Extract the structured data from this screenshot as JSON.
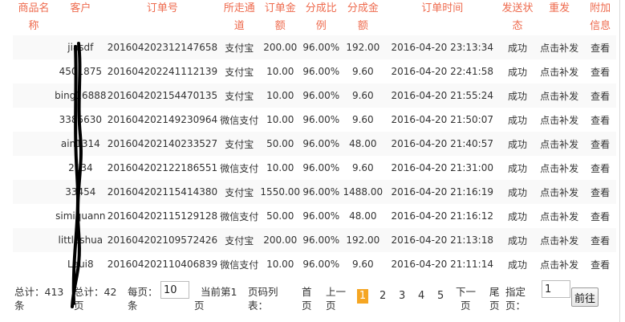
{
  "table": {
    "headers": [
      "商品名称",
      "客户",
      "订单号",
      "所走通道",
      "订单金额",
      "分成比例",
      "分成金额",
      "订单时间",
      "发送状态",
      "重发",
      "附加信息"
    ],
    "rows": [
      [
        "",
        "jiasdf",
        "201604202312147658",
        "支付宝",
        "200.00",
        "96.00%",
        "192.00",
        "2016-04-20 23:13:34",
        "成功",
        "点击补发",
        "查看"
      ],
      [
        "",
        "4501875",
        "201604202241112139",
        "支付宝",
        "10.00",
        "96.00%",
        "9.60",
        "2016-04-20 22:41:58",
        "成功",
        "点击补发",
        "查看"
      ],
      [
        "",
        "bing16888",
        "201604202154470135",
        "支付宝",
        "10.00",
        "96.00%",
        "9.60",
        "2016-04-20 21:55:24",
        "成功",
        "点击补发",
        "查看"
      ],
      [
        "",
        "3385630",
        "201604202149230964",
        "微信支付",
        "10.00",
        "96.00%",
        "9.60",
        "2016-04-20 21:50:07",
        "成功",
        "点击补发",
        "查看"
      ],
      [
        "",
        "ain1314",
        "201604202140233527",
        "支付宝",
        "50.00",
        "96.00%",
        "48.00",
        "2016-04-20 21:40:57",
        "成功",
        "点击补发",
        "查看"
      ],
      [
        "",
        "2134",
        "201604202122186551",
        "微信支付",
        "10.00",
        "96.00%",
        "9.60",
        "2016-04-20 21:31:00",
        "成功",
        "点击补发",
        "查看"
      ],
      [
        "",
        "33454",
        "201604202115414380",
        "支付宝",
        "1550.00",
        "96.00%",
        "1488.00",
        "2016-04-20 21:16:19",
        "成功",
        "点击补发",
        "查看"
      ],
      [
        "",
        "simiquann",
        "201604202115129128",
        "微信支付",
        "50.00",
        "96.00%",
        "48.00",
        "2016-04-20 21:16:12",
        "成功",
        "点击补发",
        "查看"
      ],
      [
        "",
        "littleshua",
        "201604202109572426",
        "支付宝",
        "200.00",
        "96.00%",
        "192.00",
        "2016-04-20 21:13:18",
        "成功",
        "点击补发",
        "查看"
      ],
      [
        "",
        "Laui8",
        "201604202110406839",
        "微信支付",
        "10.00",
        "96.00%",
        "9.60",
        "2016-04-20 21:11:14",
        "成功",
        "点击补发",
        "查看"
      ]
    ]
  },
  "pager": {
    "total_records": "总计：413",
    "total_records_unit": "条",
    "total_pages": "总计：42",
    "total_pages_unit": "页",
    "per_page_label": "每页：",
    "per_page_value": "10",
    "per_page_unit": "条",
    "current_page_label": "当前第1",
    "current_page_unit": "页",
    "page_list_label": "页码列",
    "page_list_label2": "表：",
    "first_label": "首",
    "first_label2": "页",
    "prev_label": "上一",
    "prev_label2": "页",
    "pages": [
      "1",
      "2",
      "3",
      "4",
      "5"
    ],
    "next_label": "下一",
    "next_label2": "页",
    "last_label": "尾",
    "last_label2": "页",
    "goto_label": "指定",
    "goto_label2": "页：",
    "goto_value": "1",
    "goto_button": "前往"
  },
  "colors": {
    "header_text": "#ee6a4d",
    "status_success": "#1e8a2e",
    "resend_link": "#1a3fb5",
    "current_page_bg": "#f5a623"
  }
}
